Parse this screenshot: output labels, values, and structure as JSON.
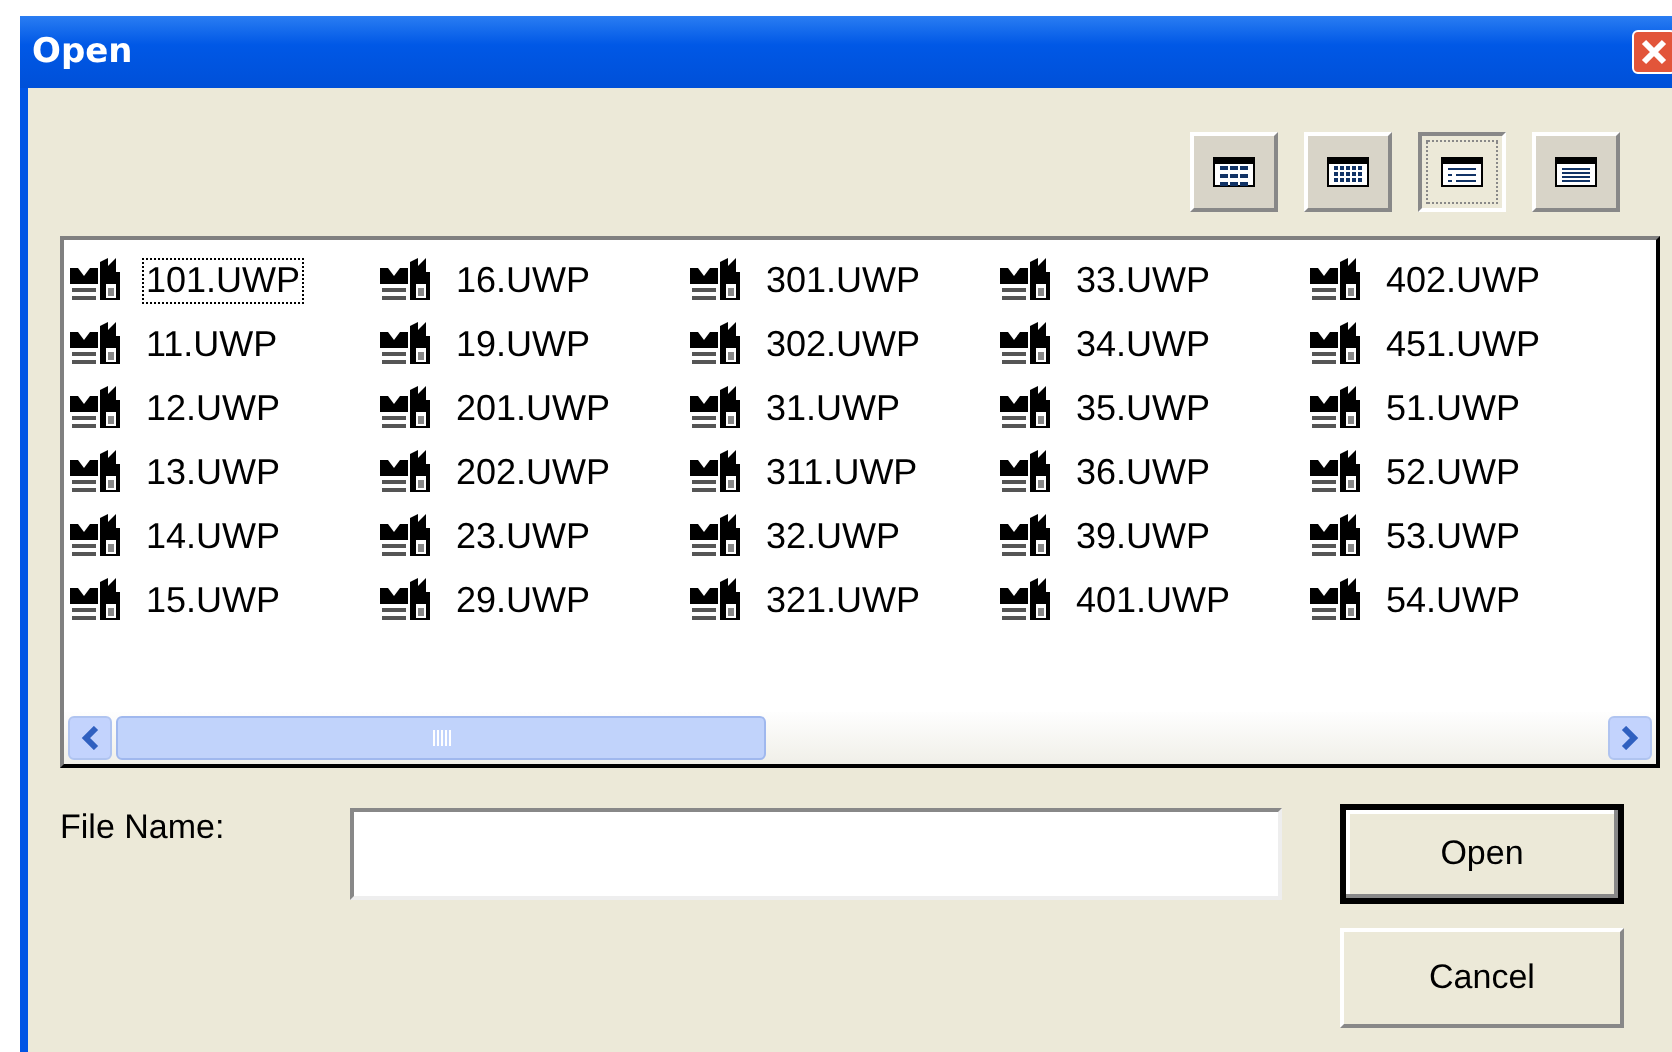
{
  "window": {
    "title": "Open"
  },
  "view_buttons": [
    {
      "selected": false
    },
    {
      "selected": false
    },
    {
      "selected": true
    },
    {
      "selected": false
    }
  ],
  "files": [
    {
      "name": "101.UWP",
      "focused": true
    },
    {
      "name": "11.UWP",
      "focused": false
    },
    {
      "name": "12.UWP",
      "focused": false
    },
    {
      "name": "13.UWP",
      "focused": false
    },
    {
      "name": "14.UWP",
      "focused": false
    },
    {
      "name": "15.UWP",
      "focused": false
    },
    {
      "name": "16.UWP",
      "focused": false
    },
    {
      "name": "19.UWP",
      "focused": false
    },
    {
      "name": "201.UWP",
      "focused": false
    },
    {
      "name": "202.UWP",
      "focused": false
    },
    {
      "name": "23.UWP",
      "focused": false
    },
    {
      "name": "29.UWP",
      "focused": false
    },
    {
      "name": "301.UWP",
      "focused": false
    },
    {
      "name": "302.UWP",
      "focused": false
    },
    {
      "name": "31.UWP",
      "focused": false
    },
    {
      "name": "311.UWP",
      "focused": false
    },
    {
      "name": "32.UWP",
      "focused": false
    },
    {
      "name": "321.UWP",
      "focused": false
    },
    {
      "name": "33.UWP",
      "focused": false
    },
    {
      "name": "34.UWP",
      "focused": false
    },
    {
      "name": "35.UWP",
      "focused": false
    },
    {
      "name": "36.UWP",
      "focused": false
    },
    {
      "name": "39.UWP",
      "focused": false
    },
    {
      "name": "401.UWP",
      "focused": false
    },
    {
      "name": "402.UWP",
      "focused": false
    },
    {
      "name": "451.UWP",
      "focused": false
    },
    {
      "name": "51.UWP",
      "focused": false
    },
    {
      "name": "52.UWP",
      "focused": false
    },
    {
      "name": "53.UWP",
      "focused": false
    },
    {
      "name": "54.UWP",
      "focused": false
    }
  ],
  "file_name": {
    "label": "File Name:"
  },
  "buttons": [
    {
      "label": "Open",
      "default": true
    },
    {
      "label": "Cancel",
      "default": false
    }
  ]
}
